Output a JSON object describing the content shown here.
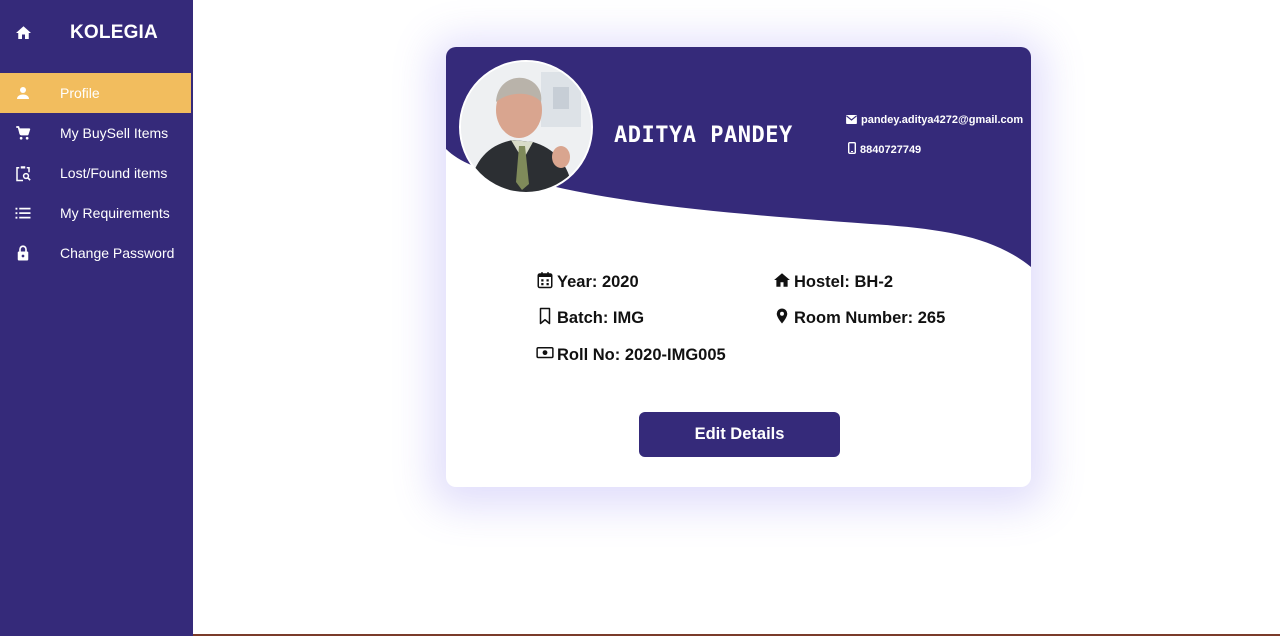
{
  "sidebar": {
    "brand": "KOLEGIA",
    "items": [
      {
        "label": "Profile",
        "icon": "person-icon",
        "active": true
      },
      {
        "label": "My BuySell Items",
        "icon": "cart-icon",
        "active": false
      },
      {
        "label": "Lost/Found items",
        "icon": "clipboard-search-icon",
        "active": false
      },
      {
        "label": "My Requirements",
        "icon": "list-icon",
        "active": false
      },
      {
        "label": "Change Password",
        "icon": "lock-icon",
        "active": false
      }
    ]
  },
  "profile": {
    "name": "ADITYA PANDEY",
    "email": "pandey.aditya4272@gmail.com",
    "phone": "8840727749",
    "details": {
      "year": "Year: 2020",
      "batch": "Batch: IMG",
      "roll_no": "Roll No: 2020-IMG005",
      "hostel": "Hostel: BH-2",
      "room": "Room Number: 265"
    },
    "edit_label": "Edit Details"
  },
  "colors": {
    "sidebar_bg": "#352a7a",
    "active_item_bg": "#f2bd5e",
    "card_header": "#352a7a",
    "button_bg": "#352a7a"
  }
}
